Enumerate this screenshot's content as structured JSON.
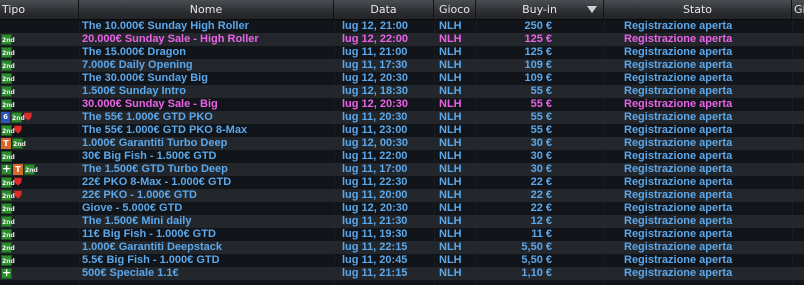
{
  "header": {
    "tipo": "Tipo",
    "nome": "Nome",
    "data": "Data",
    "gioco": "Gioco",
    "buyin": "Buy-in",
    "stato": "Stato",
    "extra": "Gi"
  },
  "rows": [
    {
      "icons": [],
      "nome": "The 10.000€ Sunday High Roller",
      "data": "lug 12, 21:00",
      "gioco": "NLH",
      "buyin": "250 €",
      "stato": "Registrazione aperta",
      "highlight": false
    },
    {
      "icons": [
        "2nd"
      ],
      "nome": "20.000€ Sunday Sale - High Roller",
      "data": "lug 12, 22:00",
      "gioco": "NLH",
      "buyin": "125 €",
      "stato": "Registrazione aperta",
      "highlight": true
    },
    {
      "icons": [
        "2nd"
      ],
      "nome": "The 15.000€ Dragon",
      "data": "lug 11, 21:00",
      "gioco": "NLH",
      "buyin": "125 €",
      "stato": "Registrazione aperta",
      "highlight": false
    },
    {
      "icons": [
        "2nd"
      ],
      "nome": "7.000€ Daily Opening",
      "data": "lug 11, 17:30",
      "gioco": "NLH",
      "buyin": "109 €",
      "stato": "Registrazione aperta",
      "highlight": false
    },
    {
      "icons": [
        "2nd"
      ],
      "nome": "The 30.000€ Sunday Big",
      "data": "lug 12, 20:30",
      "gioco": "NLH",
      "buyin": "109 €",
      "stato": "Registrazione aperta",
      "highlight": false
    },
    {
      "icons": [
        "2nd"
      ],
      "nome": "1.500€ Sunday Intro",
      "data": "lug 12, 18:30",
      "gioco": "NLH",
      "buyin": "55 €",
      "stato": "Registrazione aperta",
      "highlight": false
    },
    {
      "icons": [
        "2nd"
      ],
      "nome": "30.000€ Sunday Sale - Big",
      "data": "lug 12, 20:30",
      "gioco": "NLH",
      "buyin": "55 €",
      "stato": "Registrazione aperta",
      "highlight": true
    },
    {
      "icons": [
        "6",
        "2nd",
        "shield"
      ],
      "nome": "The 55€ 1.000€ GTD PKO",
      "data": "lug 11, 20:30",
      "gioco": "NLH",
      "buyin": "55 €",
      "stato": "Registrazione aperta",
      "highlight": false
    },
    {
      "icons": [
        "2nd",
        "shield"
      ],
      "nome": "The 55€ 1.000€ GTD PKO 8-Max",
      "data": "lug 11, 23:00",
      "gioco": "NLH",
      "buyin": "55 €",
      "stato": "Registrazione aperta",
      "highlight": false
    },
    {
      "icons": [
        "T",
        "2nd"
      ],
      "nome": "1.000€ Garantiti Turbo Deep",
      "data": "lug 12, 00:30",
      "gioco": "NLH",
      "buyin": "30 €",
      "stato": "Registrazione aperta",
      "highlight": false
    },
    {
      "icons": [
        "2nd"
      ],
      "nome": "30€ Big Fish - 1.500€ GTD",
      "data": "lug 11, 22:00",
      "gioco": "NLH",
      "buyin": "30 €",
      "stato": "Registrazione aperta",
      "highlight": false
    },
    {
      "icons": [
        "+",
        "T",
        "2nd"
      ],
      "nome": "The 1.500€ GTD  Turbo Deep",
      "data": "lug 11, 17:00",
      "gioco": "NLH",
      "buyin": "30 €",
      "stato": "Registrazione aperta",
      "highlight": false
    },
    {
      "icons": [
        "2nd",
        "shield"
      ],
      "nome": "22€ PKO 8-Max - 1.000€ GTD",
      "data": "lug 11, 22:30",
      "gioco": "NLH",
      "buyin": "22 €",
      "stato": "Registrazione aperta",
      "highlight": false
    },
    {
      "icons": [
        "2nd",
        "shield"
      ],
      "nome": "22€ PKO - 1.000€ GTD",
      "data": "lug 11, 20:00",
      "gioco": "NLH",
      "buyin": "22 €",
      "stato": "Registrazione aperta",
      "highlight": false
    },
    {
      "icons": [
        "2nd"
      ],
      "nome": "Giove - 5.000€ GTD",
      "data": "lug 12, 20:30",
      "gioco": "NLH",
      "buyin": "22 €",
      "stato": "Registrazione aperta",
      "highlight": false
    },
    {
      "icons": [
        "2nd"
      ],
      "nome": "The 1.500€ Mini daily",
      "data": "lug 11, 21:30",
      "gioco": "NLH",
      "buyin": "12 €",
      "stato": "Registrazione aperta",
      "highlight": false
    },
    {
      "icons": [
        "2nd"
      ],
      "nome": "11€ Big Fish - 1.000€ GTD",
      "data": "lug 11, 19:30",
      "gioco": "NLH",
      "buyin": "11 €",
      "stato": "Registrazione aperta",
      "highlight": false
    },
    {
      "icons": [
        "2nd"
      ],
      "nome": "1.000€ Garantiti Deepstack",
      "data": "lug 11, 22:15",
      "gioco": "NLH",
      "buyin": "5,50 €",
      "stato": "Registrazione aperta",
      "highlight": false
    },
    {
      "icons": [
        "2nd"
      ],
      "nome": "5.5€ Big Fish - 1.000€ GTD",
      "data": "lug 11, 20:45",
      "gioco": "NLH",
      "buyin": "5,50 €",
      "stato": "Registrazione aperta",
      "highlight": false
    },
    {
      "icons": [
        "+"
      ],
      "nome": "500€ Speciale 1.1€",
      "data": "lug 11, 21:15",
      "gioco": "NLH",
      "buyin": "1,10 €",
      "stato": "Registrazione aperta",
      "highlight": false
    }
  ],
  "colors": {
    "text": "#5ba7ea",
    "highlight": "#ea62e8",
    "row_alt": "#23272c",
    "background": "#111418"
  }
}
